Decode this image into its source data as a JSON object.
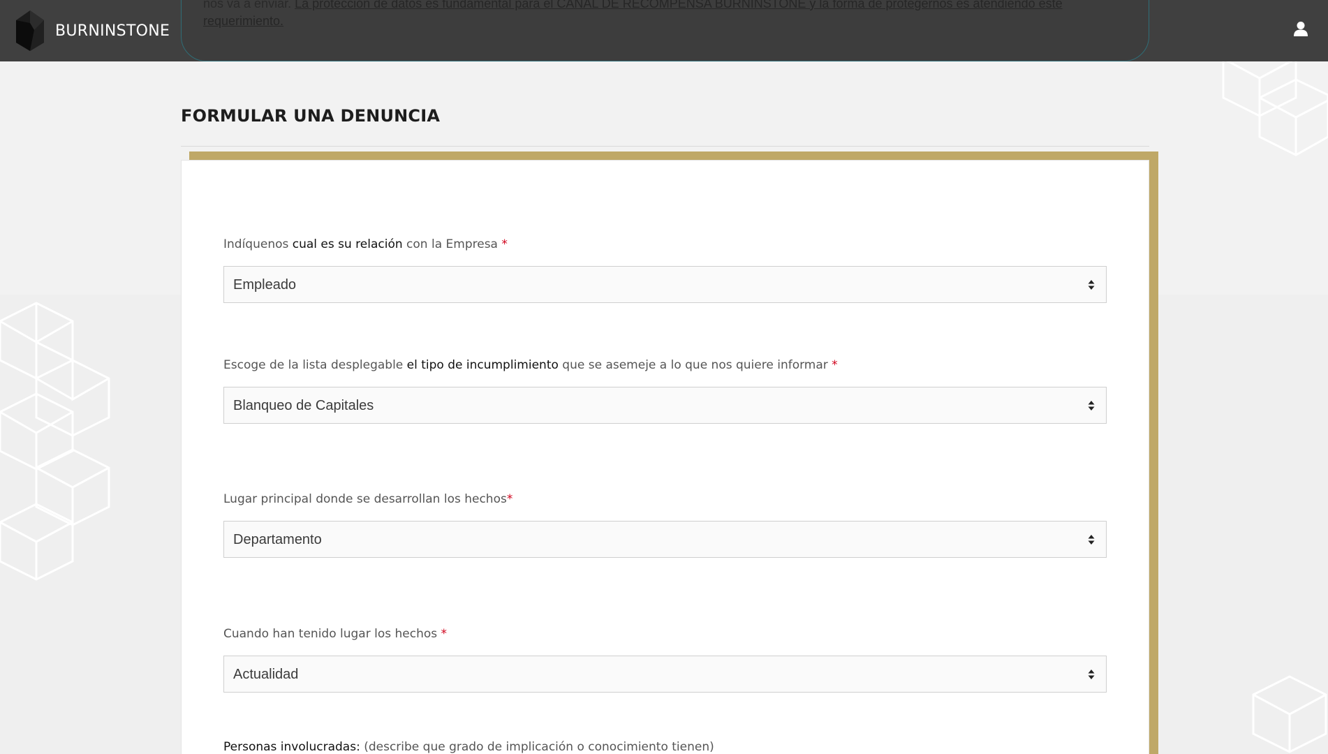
{
  "header": {
    "brand_name": "BURNINSTONE",
    "notice_prefix": "nos va a enviar.",
    "notice_link": "La protección de datos es fundamental para el CANAL DE RECOMPENSA BURNINSTONE y la forma de protegernos es atendiendo este requerimiento.",
    "user_icon": "user-icon"
  },
  "page": {
    "title": "FORMULAR UNA DENUNCIA"
  },
  "form": {
    "relation": {
      "label_pre": "Indíquenos ",
      "label_bold": "cual es su relación",
      "label_post": " con la Empresa ",
      "required": "*",
      "value": "Empleado"
    },
    "breach_type": {
      "label_pre": "Escoge de la lista desplegable ",
      "label_bold": "el tipo de incumplimiento",
      "label_post": " que se asemeje a lo que nos quiere informar ",
      "required": "*",
      "value": "Blanqueo de Capitales"
    },
    "location": {
      "label": "Lugar principal donde se desarrollan los hechos",
      "required": "*",
      "value": "Departamento"
    },
    "when": {
      "label": "Cuando han tenido lugar los hechos ",
      "required": "*",
      "value": "Actualidad"
    },
    "people": {
      "label_bold": "Personas involucradas:",
      "label_post": " (describe que grado de implicación o conocimiento tienen)"
    }
  },
  "colors": {
    "header_bg": "#404040",
    "accent_gold": "#bfa867",
    "required_red": "#d0021b",
    "page_bg": "#f2f2f2"
  }
}
